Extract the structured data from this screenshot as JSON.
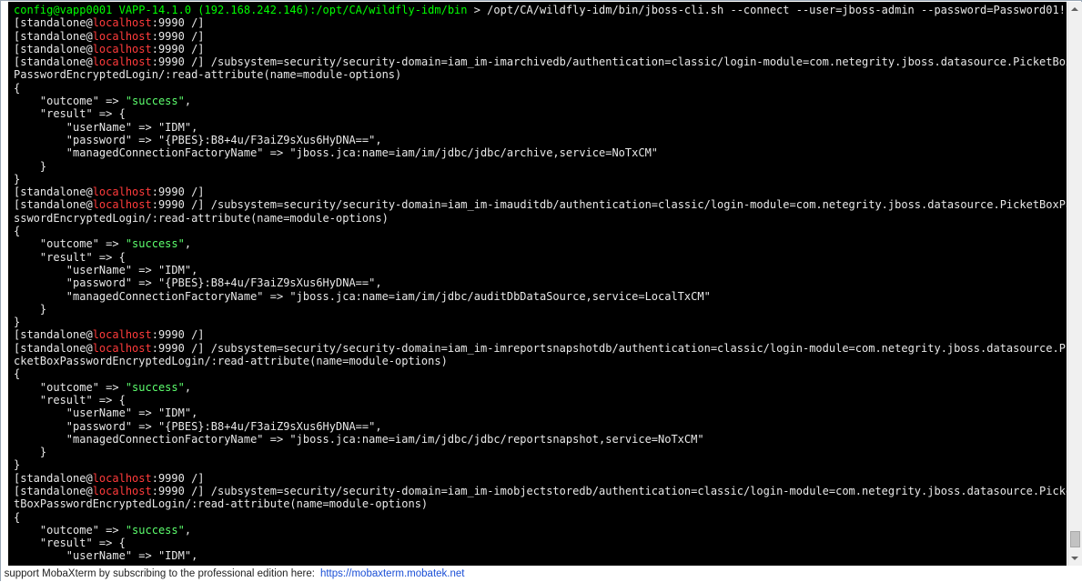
{
  "terminal": {
    "lines": [
      {
        "parts": [
          {
            "t": "config@vapp0001 VAPP-14.1.0 (192.168.242.146):/opt/CA/wildfly-idm/bin",
            "c": "green"
          },
          {
            "t": " > /opt/CA/wildfly-idm/bin/jboss-cli.sh --connect --user=jboss-admin --password=Password01!",
            "c": ""
          }
        ]
      },
      {
        "parts": [
          {
            "t": "[standalone@",
            "c": ""
          },
          {
            "t": "localhost",
            "c": "red"
          },
          {
            "t": ":9990 /]",
            "c": ""
          }
        ]
      },
      {
        "parts": [
          {
            "t": "[standalone@",
            "c": ""
          },
          {
            "t": "localhost",
            "c": "red"
          },
          {
            "t": ":9990 /]",
            "c": ""
          }
        ]
      },
      {
        "parts": [
          {
            "t": "[standalone@",
            "c": ""
          },
          {
            "t": "localhost",
            "c": "red"
          },
          {
            "t": ":9990 /]",
            "c": ""
          }
        ]
      },
      {
        "parts": [
          {
            "t": "[standalone@",
            "c": ""
          },
          {
            "t": "localhost",
            "c": "red"
          },
          {
            "t": ":9990 /] /subsystem=security/security-domain=iam_im-imarchivedb/authentication=classic/login-module=com.netegrity.jboss.datasource.PicketBox",
            "c": ""
          }
        ]
      },
      {
        "parts": [
          {
            "t": "PasswordEncryptedLogin/:read-attribute(name=module-options)",
            "c": ""
          }
        ]
      },
      {
        "parts": [
          {
            "t": "{",
            "c": ""
          }
        ]
      },
      {
        "parts": [
          {
            "t": "    \"outcome\" => ",
            "c": ""
          },
          {
            "t": "\"success\"",
            "c": "lgreen"
          },
          {
            "t": ",",
            "c": ""
          }
        ]
      },
      {
        "parts": [
          {
            "t": "    \"result\" => {",
            "c": ""
          }
        ]
      },
      {
        "parts": [
          {
            "t": "        \"userName\" => \"IDM\",",
            "c": ""
          }
        ]
      },
      {
        "parts": [
          {
            "t": "        \"password\" => \"{PBES}:B8+4u/F3aiZ9sXus6HyDNA==\",",
            "c": ""
          }
        ]
      },
      {
        "parts": [
          {
            "t": "        \"managedConnectionFactoryName\" => \"jboss.jca:name=iam/im/jdbc/jdbc/archive,service=NoTxCM\"",
            "c": ""
          }
        ]
      },
      {
        "parts": [
          {
            "t": "    }",
            "c": ""
          }
        ]
      },
      {
        "parts": [
          {
            "t": "}",
            "c": ""
          }
        ]
      },
      {
        "parts": [
          {
            "t": "[standalone@",
            "c": ""
          },
          {
            "t": "localhost",
            "c": "red"
          },
          {
            "t": ":9990 /]",
            "c": ""
          }
        ]
      },
      {
        "parts": [
          {
            "t": "[standalone@",
            "c": ""
          },
          {
            "t": "localhost",
            "c": "red"
          },
          {
            "t": ":9990 /] /subsystem=security/security-domain=iam_im-imauditdb/authentication=classic/login-module=com.netegrity.jboss.datasource.PicketBoxPa",
            "c": ""
          }
        ]
      },
      {
        "parts": [
          {
            "t": "sswordEncryptedLogin/:read-attribute(name=module-options)",
            "c": ""
          }
        ]
      },
      {
        "parts": [
          {
            "t": "{",
            "c": ""
          }
        ]
      },
      {
        "parts": [
          {
            "t": "    \"outcome\" => ",
            "c": ""
          },
          {
            "t": "\"success\"",
            "c": "lgreen"
          },
          {
            "t": ",",
            "c": ""
          }
        ]
      },
      {
        "parts": [
          {
            "t": "    \"result\" => {",
            "c": ""
          }
        ]
      },
      {
        "parts": [
          {
            "t": "        \"userName\" => \"IDM\",",
            "c": ""
          }
        ]
      },
      {
        "parts": [
          {
            "t": "        \"password\" => \"{PBES}:B8+4u/F3aiZ9sXus6HyDNA==\",",
            "c": ""
          }
        ]
      },
      {
        "parts": [
          {
            "t": "        \"managedConnectionFactoryName\" => \"jboss.jca:name=iam/im/jdbc/auditDbDataSource,service=LocalTxCM\"",
            "c": ""
          }
        ]
      },
      {
        "parts": [
          {
            "t": "    }",
            "c": ""
          }
        ]
      },
      {
        "parts": [
          {
            "t": "}",
            "c": ""
          }
        ]
      },
      {
        "parts": [
          {
            "t": "[standalone@",
            "c": ""
          },
          {
            "t": "localhost",
            "c": "red"
          },
          {
            "t": ":9990 /]",
            "c": ""
          }
        ]
      },
      {
        "parts": [
          {
            "t": "[standalone@",
            "c": ""
          },
          {
            "t": "localhost",
            "c": "red"
          },
          {
            "t": ":9990 /] /subsystem=security/security-domain=iam_im-imreportsnapshotdb/authentication=classic/login-module=com.netegrity.jboss.datasource.Pi",
            "c": ""
          }
        ]
      },
      {
        "parts": [
          {
            "t": "cketBoxPasswordEncryptedLogin/:read-attribute(name=module-options)",
            "c": ""
          }
        ]
      },
      {
        "parts": [
          {
            "t": "{",
            "c": ""
          }
        ]
      },
      {
        "parts": [
          {
            "t": "    \"outcome\" => ",
            "c": ""
          },
          {
            "t": "\"success\"",
            "c": "lgreen"
          },
          {
            "t": ",",
            "c": ""
          }
        ]
      },
      {
        "parts": [
          {
            "t": "    \"result\" => {",
            "c": ""
          }
        ]
      },
      {
        "parts": [
          {
            "t": "        \"userName\" => \"IDM\",",
            "c": ""
          }
        ]
      },
      {
        "parts": [
          {
            "t": "        \"password\" => \"{PBES}:B8+4u/F3aiZ9sXus6HyDNA==\",",
            "c": ""
          }
        ]
      },
      {
        "parts": [
          {
            "t": "        \"managedConnectionFactoryName\" => \"jboss.jca:name=iam/im/jdbc/jdbc/reportsnapshot,service=NoTxCM\"",
            "c": ""
          }
        ]
      },
      {
        "parts": [
          {
            "t": "    }",
            "c": ""
          }
        ]
      },
      {
        "parts": [
          {
            "t": "}",
            "c": ""
          }
        ]
      },
      {
        "parts": [
          {
            "t": "[standalone@",
            "c": ""
          },
          {
            "t": "localhost",
            "c": "red"
          },
          {
            "t": ":9990 /]",
            "c": ""
          }
        ]
      },
      {
        "parts": [
          {
            "t": "[standalone@",
            "c": ""
          },
          {
            "t": "localhost",
            "c": "red"
          },
          {
            "t": ":9990 /] /subsystem=security/security-domain=iam_im-imobjectstoredb/authentication=classic/login-module=com.netegrity.jboss.datasource.Picke",
            "c": ""
          }
        ]
      },
      {
        "parts": [
          {
            "t": "tBoxPasswordEncryptedLogin/:read-attribute(name=module-options)",
            "c": ""
          }
        ]
      },
      {
        "parts": [
          {
            "t": "{",
            "c": ""
          }
        ]
      },
      {
        "parts": [
          {
            "t": "    \"outcome\" => ",
            "c": ""
          },
          {
            "t": "\"success\"",
            "c": "lgreen"
          },
          {
            "t": ",",
            "c": ""
          }
        ]
      },
      {
        "parts": [
          {
            "t": "    \"result\" => {",
            "c": ""
          }
        ]
      },
      {
        "parts": [
          {
            "t": "        \"userName\" => \"IDM\",",
            "c": ""
          }
        ]
      }
    ]
  },
  "statusbar": {
    "text": "e support MobaXterm by subscribing to the professional edition here:",
    "link": "https://mobaxterm.mobatek.net"
  },
  "colors": {
    "prompt": "#00ff00",
    "host": "#ff3b3b",
    "success": "#5dff6e",
    "text": "#e8e8e8",
    "background": "#000000",
    "link": "#1a4fd6"
  }
}
